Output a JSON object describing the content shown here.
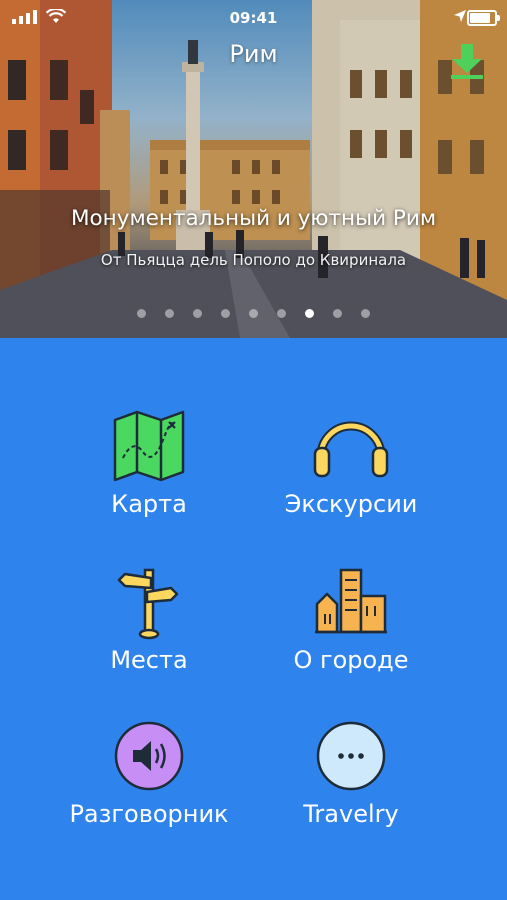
{
  "status_bar": {
    "time": "09:41"
  },
  "header": {
    "city": "Рим",
    "download_icon": "download-icon"
  },
  "hero": {
    "title": "Монументальный и уютный Рим",
    "subtitle": "От Пьяцца дель Пополо до Квиринала",
    "slides_total": 9,
    "active_slide": 7
  },
  "menu": {
    "map": {
      "label": "Карта",
      "icon": "map-icon"
    },
    "tours": {
      "label": "Экскурсии",
      "icon": "headphones-icon"
    },
    "places": {
      "label": "Места",
      "icon": "signpost-icon"
    },
    "city": {
      "label": "О городе",
      "icon": "city-buildings-icon"
    },
    "phrasebook": {
      "label": "Разговорник",
      "icon": "speaker-icon"
    },
    "travelry": {
      "label": "Travelry",
      "icon": "more-dots-icon"
    }
  },
  "colors": {
    "background": "#2e83ec",
    "map_green": "#4bd861",
    "icon_yellow": "#fbd760",
    "icon_orange": "#f7b34f",
    "speaker_purple": "#c78ef5",
    "dots_blue": "#cde9fb",
    "download_green": "#4ed05a"
  }
}
